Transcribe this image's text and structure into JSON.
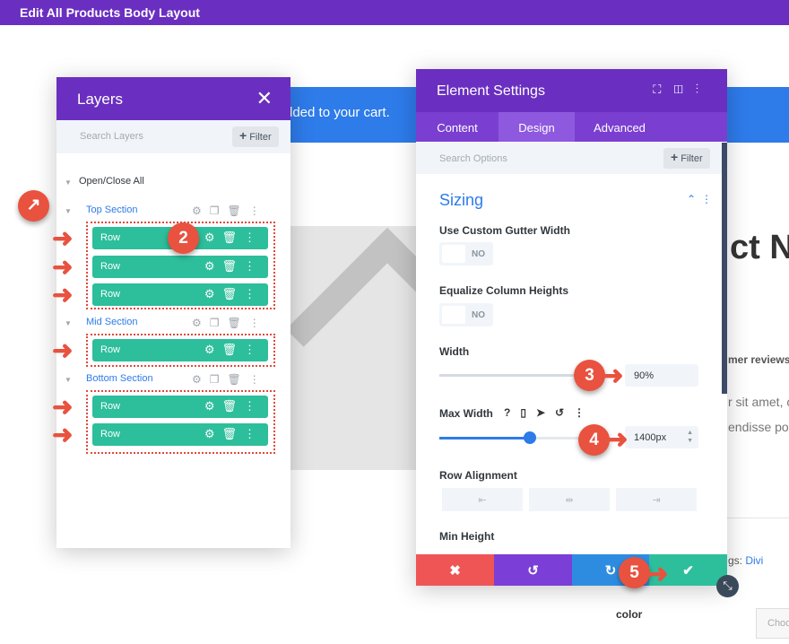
{
  "window": {
    "title": "Edit All Products Body Layout"
  },
  "background": {
    "cart_notice": "dded to your cart.",
    "product_title": "ct Na",
    "reviews": "mer reviews)",
    "text_line1": "r sit amet, c",
    "text_line2": "endisse po",
    "tags_label": "gs: ",
    "tags_value": "Divi",
    "color_label": "color",
    "choose_label": "Choo"
  },
  "layers": {
    "title": "Layers",
    "search_placeholder": "Search Layers",
    "filter_label": "Filter",
    "open_close_all": "Open/Close All",
    "sections": [
      {
        "name": "Top Section",
        "rows": [
          "Row",
          "Row",
          "Row"
        ]
      },
      {
        "name": "Mid Section",
        "rows": [
          "Row"
        ]
      },
      {
        "name": "Bottom Section",
        "rows": [
          "Row",
          "Row"
        ]
      }
    ]
  },
  "badges": [
    "2",
    "3",
    "4",
    "5"
  ],
  "settings": {
    "title": "Element Settings",
    "tabs": [
      "Content",
      "Design",
      "Advanced"
    ],
    "active_tab": "Design",
    "search_placeholder": "Search Options",
    "filter_label": "Filter",
    "group_title": "Sizing",
    "fields": {
      "gutter_label": "Use Custom Gutter Width",
      "gutter_value": "NO",
      "equalize_label": "Equalize Column Heights",
      "equalize_value": "NO",
      "width_label": "Width",
      "width_value": "90%",
      "max_width_label": "Max Width",
      "max_width_value": "1400px",
      "max_width_help": "?",
      "row_alignment_label": "Row Alignment",
      "min_height_label": "Min Height"
    },
    "footer_colors": {
      "discard": "#ef5555",
      "undo": "#7b3ed6",
      "redo": "#2e8ce0",
      "save": "#2dbe9b"
    }
  },
  "colors": {
    "purple": "#6a2fc0",
    "teal": "#2dbe9b",
    "blue": "#2e7bea",
    "red": "#e8523f"
  }
}
